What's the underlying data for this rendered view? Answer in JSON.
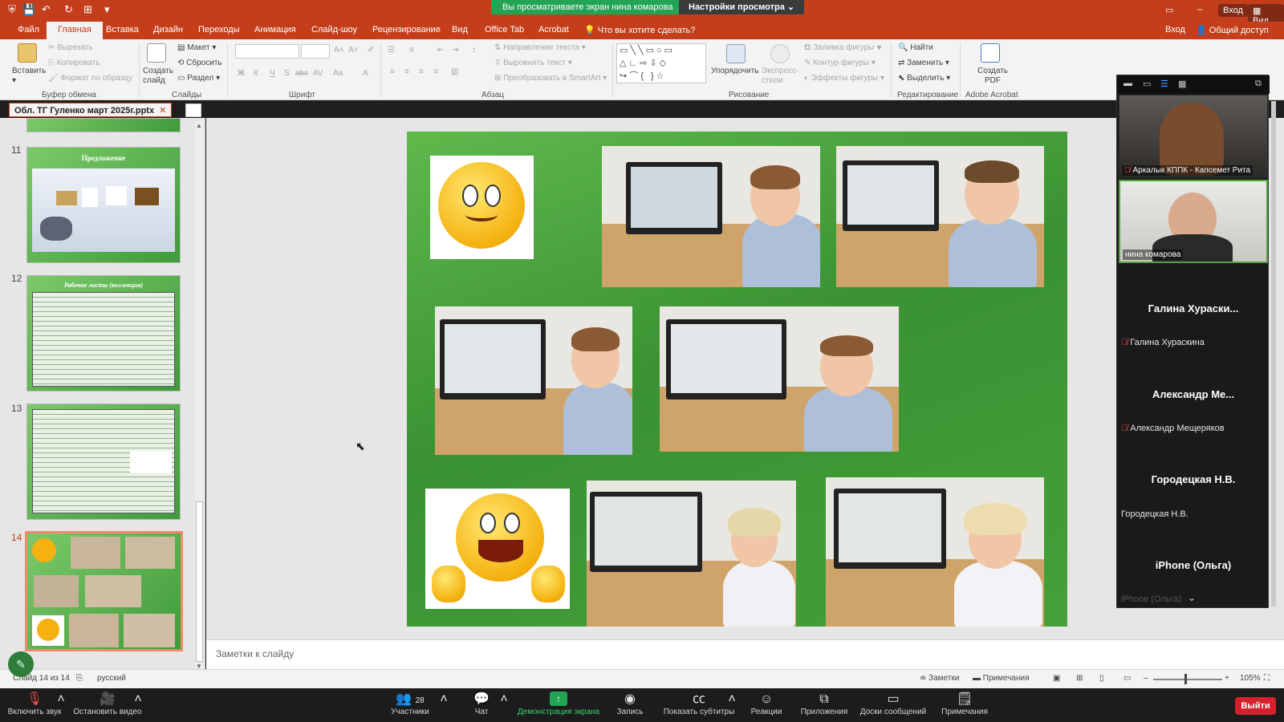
{
  "share": {
    "banner": "Вы просматриваете экран нина комарова",
    "settings": "Настройки просмотра"
  },
  "titlebar": {
    "login": "Вход",
    "view": "Вид"
  },
  "ribbon_tabs": [
    "Файл",
    "Главная",
    "Вставка",
    "Дизайн",
    "Переходы",
    "Анимация",
    "Слайд-шоу",
    "Рецензирование",
    "Вид",
    "Office Tab",
    "Acrobat"
  ],
  "tell_me": "Что вы хотите сделать?",
  "account": {
    "login": "Вход",
    "share": "Общий доступ"
  },
  "ribbon": {
    "paste": "Вставить",
    "cut": "Вырезать",
    "copy": "Копировать",
    "format_painter": "Формат по образцу",
    "clipboard_group": "Буфер обмена",
    "new_slide": "Создать слайд",
    "layout": "Макет",
    "reset": "Сбросить",
    "section": "Раздел",
    "slides_group": "Слайды",
    "font_group": "Шрифт",
    "text_direction": "Направление текста",
    "align_text": "Выровнять текст",
    "smartart": "Преобразовать в SmartArt",
    "paragraph_group": "Абзац",
    "arrange": "Упорядочить",
    "quick_styles": "Экспресс-стили",
    "shape_fill": "Заливка фигуры",
    "shape_outline": "Контур фигуры",
    "shape_effects": "Эффекты фигуры",
    "drawing_group": "Рисование",
    "find": "Найти",
    "replace": "Заменить",
    "select": "Выделить",
    "editing_group": "Редактирование",
    "create_pdf": "Создать PDF",
    "acrobat_group": "Adobe Acrobat"
  },
  "document_tab": "Обл. ТГ  Гуленко март 2025г.pptx",
  "thumbnails": [
    {
      "num": "11",
      "title": "Предложение"
    },
    {
      "num": "12",
      "title": "Рабочие листы (коллекция)"
    },
    {
      "num": "13",
      "title": ""
    },
    {
      "num": "14",
      "title": ""
    }
  ],
  "notes_placeholder": "Заметки к слайду",
  "status": {
    "slide_of": "Слайд 14 из 14",
    "language": "русский",
    "notes": "Заметки",
    "comments": "Примечания",
    "zoom": "105%"
  },
  "gallery": {
    "participants": [
      {
        "name": "Аркалык КППК - Капсемет Рита",
        "muted": true
      },
      {
        "name": "нина комарова",
        "muted": false
      },
      {
        "big": "Галина Хураски...",
        "name": "Галина Хураскина",
        "muted": true
      },
      {
        "big": "Александр Ме...",
        "name": "Александр Мещеряков",
        "muted": true
      },
      {
        "big": "Городецкая Н.В.",
        "name": "Городецкая Н.В.",
        "muted": false
      },
      {
        "big": "iPhone (Ольга)",
        "name": "iPhone (Ольга)",
        "muted": false
      }
    ]
  },
  "zoom_toolbar": {
    "unmute": "Включить звук",
    "stop_video": "Остановить видео",
    "participants": "Участники",
    "participants_count": "28",
    "chat": "Чат",
    "share_screen": "Демонстрация экрана",
    "record": "Запись",
    "captions": "Показать субтитры",
    "reactions": "Реакции",
    "apps": "Приложения",
    "whiteboards": "Доски сообщений",
    "notes": "Примечания",
    "leave": "Выйти"
  }
}
